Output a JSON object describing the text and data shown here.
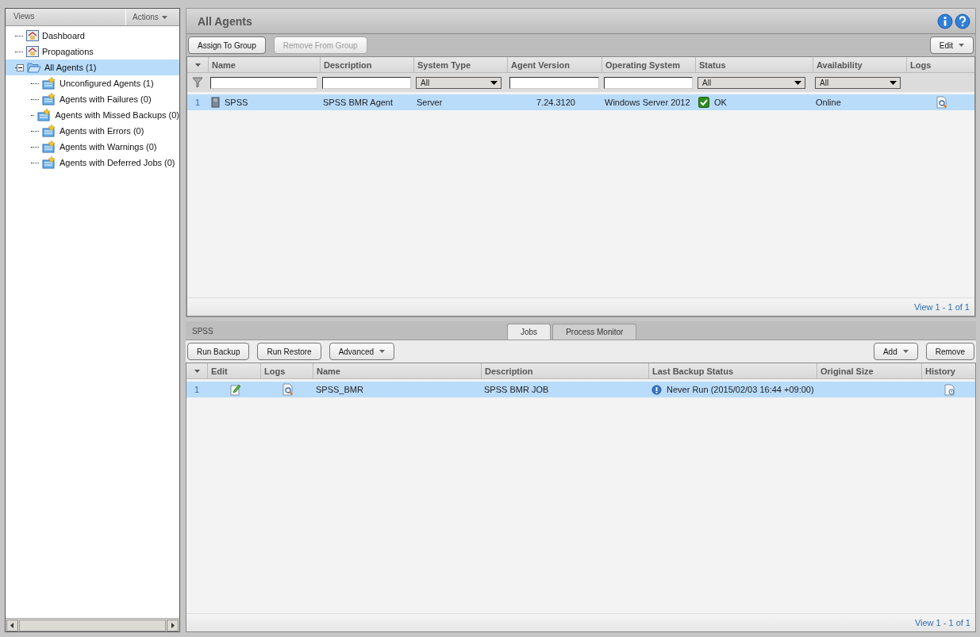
{
  "sidebar": {
    "title": "Views",
    "actions_button": "Actions",
    "tree": [
      {
        "label": "Dashboard",
        "kind": "page",
        "selected": false
      },
      {
        "label": "Propagations",
        "kind": "page",
        "selected": false
      },
      {
        "label": "All Agents (1)",
        "kind": "folder",
        "selected": true,
        "expanded": true,
        "children": [
          {
            "label": "Unconfigured Agents (1)",
            "kind": "group",
            "selected": false
          },
          {
            "label": "Agents with Failures (0)",
            "kind": "group",
            "selected": false
          },
          {
            "label": "Agents with Missed Backups (0)",
            "kind": "group",
            "selected": false
          },
          {
            "label": "Agents with Errors (0)",
            "kind": "group",
            "selected": false
          },
          {
            "label": "Agents with Warnings (0)",
            "kind": "group",
            "selected": false
          },
          {
            "label": "Agents with Deferred Jobs (0)",
            "kind": "group",
            "selected": false
          }
        ]
      }
    ]
  },
  "main": {
    "title": "All Agents",
    "toolbar": [
      {
        "label": "Assign To Group",
        "disabled": false
      },
      {
        "label": "Remove From Group",
        "disabled": true
      }
    ],
    "edit_button": "Edit",
    "agents_table": {
      "columns": [
        "Name",
        "Description",
        "System Type",
        "Agent Version",
        "Operating System",
        "Status",
        "Availability",
        "Logs"
      ],
      "filters": [
        {
          "kind": "text"
        },
        {
          "kind": "text"
        },
        {
          "kind": "select",
          "value": "All"
        },
        {
          "kind": "text"
        },
        {
          "kind": "text"
        },
        {
          "kind": "select",
          "value": "All"
        },
        {
          "kind": "select",
          "value": "All"
        },
        {
          "kind": "none"
        }
      ],
      "rows": [
        {
          "number": "1",
          "name": "SPSS",
          "description": "SPSS BMR Agent",
          "system_type": "Server",
          "agent_version": "7.24.3120",
          "operating_system": "Windows Server 2012",
          "status": "OK",
          "availability": "Online",
          "selected": true
        }
      ],
      "pager": "View 1 - 1 of 1"
    }
  },
  "details": {
    "title": "SPSS",
    "tabs": [
      {
        "label": "Jobs",
        "selected": true
      },
      {
        "label": "Process Monitor",
        "selected": false
      }
    ],
    "left_buttons": [
      {
        "label": "Run Backup",
        "menu": false
      },
      {
        "label": "Run Restore",
        "menu": false
      },
      {
        "label": "Advanced",
        "menu": true
      }
    ],
    "right_buttons": [
      {
        "label": "Add",
        "menu": true
      },
      {
        "label": "Remove",
        "menu": false
      }
    ],
    "jobs_table": {
      "columns": [
        "Edit",
        "Logs",
        "Name",
        "Description",
        "Last Backup Status",
        "Original Size",
        "History"
      ],
      "rows": [
        {
          "number": "1",
          "name": "SPSS_BMR",
          "description": "SPSS BMR JOB",
          "last_backup_status": "Never Run (2015/02/03 16:44 +09:00)",
          "selected": true
        }
      ],
      "pager": "View 1 - 1 of 1"
    }
  }
}
